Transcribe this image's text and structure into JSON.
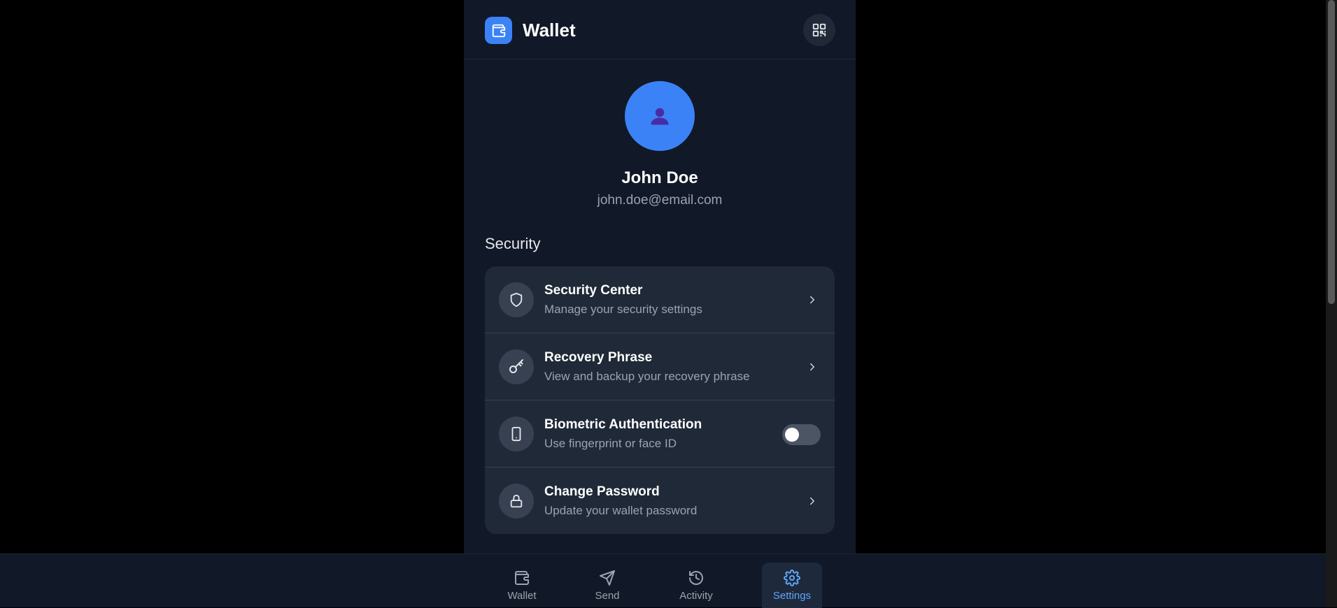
{
  "header": {
    "title": "Wallet",
    "logo_icon": "wallet-icon",
    "qr_icon": "qr-code-icon"
  },
  "profile": {
    "avatar_icon": "user-icon",
    "name": "John Doe",
    "email": "john.doe@email.com"
  },
  "security": {
    "section_title": "Security",
    "items": [
      {
        "title": "Security Center",
        "subtitle": "Manage your security settings",
        "icon": "shield-icon",
        "control": "chevron"
      },
      {
        "title": "Recovery Phrase",
        "subtitle": "View and backup your recovery phrase",
        "icon": "key-icon",
        "control": "chevron"
      },
      {
        "title": "Biometric Authentication",
        "subtitle": "Use fingerprint or face ID",
        "icon": "phone-icon",
        "control": "toggle",
        "enabled": false
      },
      {
        "title": "Change Password",
        "subtitle": "Update your wallet password",
        "icon": "lock-icon",
        "control": "chevron"
      }
    ]
  },
  "nav": {
    "items": [
      {
        "label": "Wallet",
        "icon": "wallet-icon",
        "active": false
      },
      {
        "label": "Send",
        "icon": "send-icon",
        "active": false
      },
      {
        "label": "Activity",
        "icon": "history-icon",
        "active": false
      },
      {
        "label": "Settings",
        "icon": "gear-icon",
        "active": true
      }
    ]
  },
  "colors": {
    "accent": "#3b82f6",
    "background": "#111827",
    "card": "#1f2937",
    "active_nav": "#60a5fa"
  }
}
